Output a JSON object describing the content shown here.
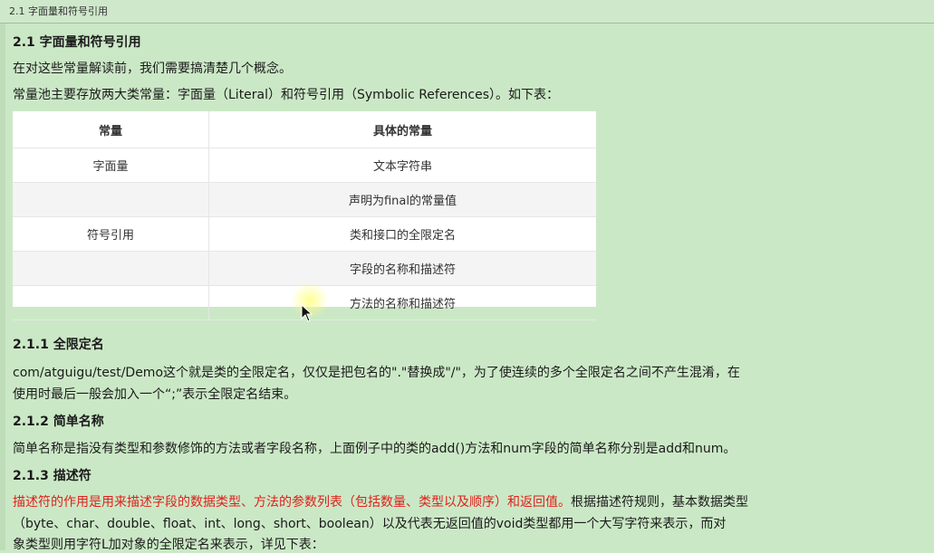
{
  "header": {
    "tab_title": "2.1 字面量和符号引用"
  },
  "section": {
    "title": "2.1 字面量和符号引用",
    "intro": "在对这些常量解读前，我们需要搞清楚几个概念。",
    "pool_line": "常量池主要存放两大类常量：字面量（Literal）和符号引用（Symbolic References）。如下表：",
    "table": {
      "headers": [
        "常量",
        "具体的常量"
      ],
      "rows": [
        [
          "字面量",
          "文本字符串"
        ],
        [
          "",
          "声明为final的常量值"
        ],
        [
          "符号引用",
          "类和接口的全限定名"
        ],
        [
          "",
          "字段的名称和描述符"
        ],
        [
          "",
          "方法的名称和描述符"
        ]
      ]
    },
    "sub1": {
      "title": "2.1.1 全限定名",
      "line1": "com/atguigu/test/Demo这个就是类的全限定名，仅仅是把包名的\".\"替换成\"/\"，为了使连续的多个全限定名之间不产生混淆，在",
      "line2": "使用时最后一般会加入一个“;”表示全限定名结束。"
    },
    "sub2": {
      "title": "2.1.2 简单名称",
      "line1": "简单名称是指没有类型和参数修饰的方法或者字段名称，上面例子中的类的add()方法和num字段的简单名称分别是add和num。"
    },
    "sub3": {
      "title": "2.1.3 描述符",
      "line1_red": "描述符的作用是用来描述字段的数据类型、方法的参数列表（包括数量、类型以及顺序）和返回值。",
      "line1_rest": "根据描述符规则，基本数据类型",
      "line2": "（byte、char、double、float、int、long、short、boolean）以及代表无返回值的void类型都用一个大写字符来表示，而对",
      "line3": "象类型则用字符L加对象的全限定名来表示，详见下表："
    }
  }
}
